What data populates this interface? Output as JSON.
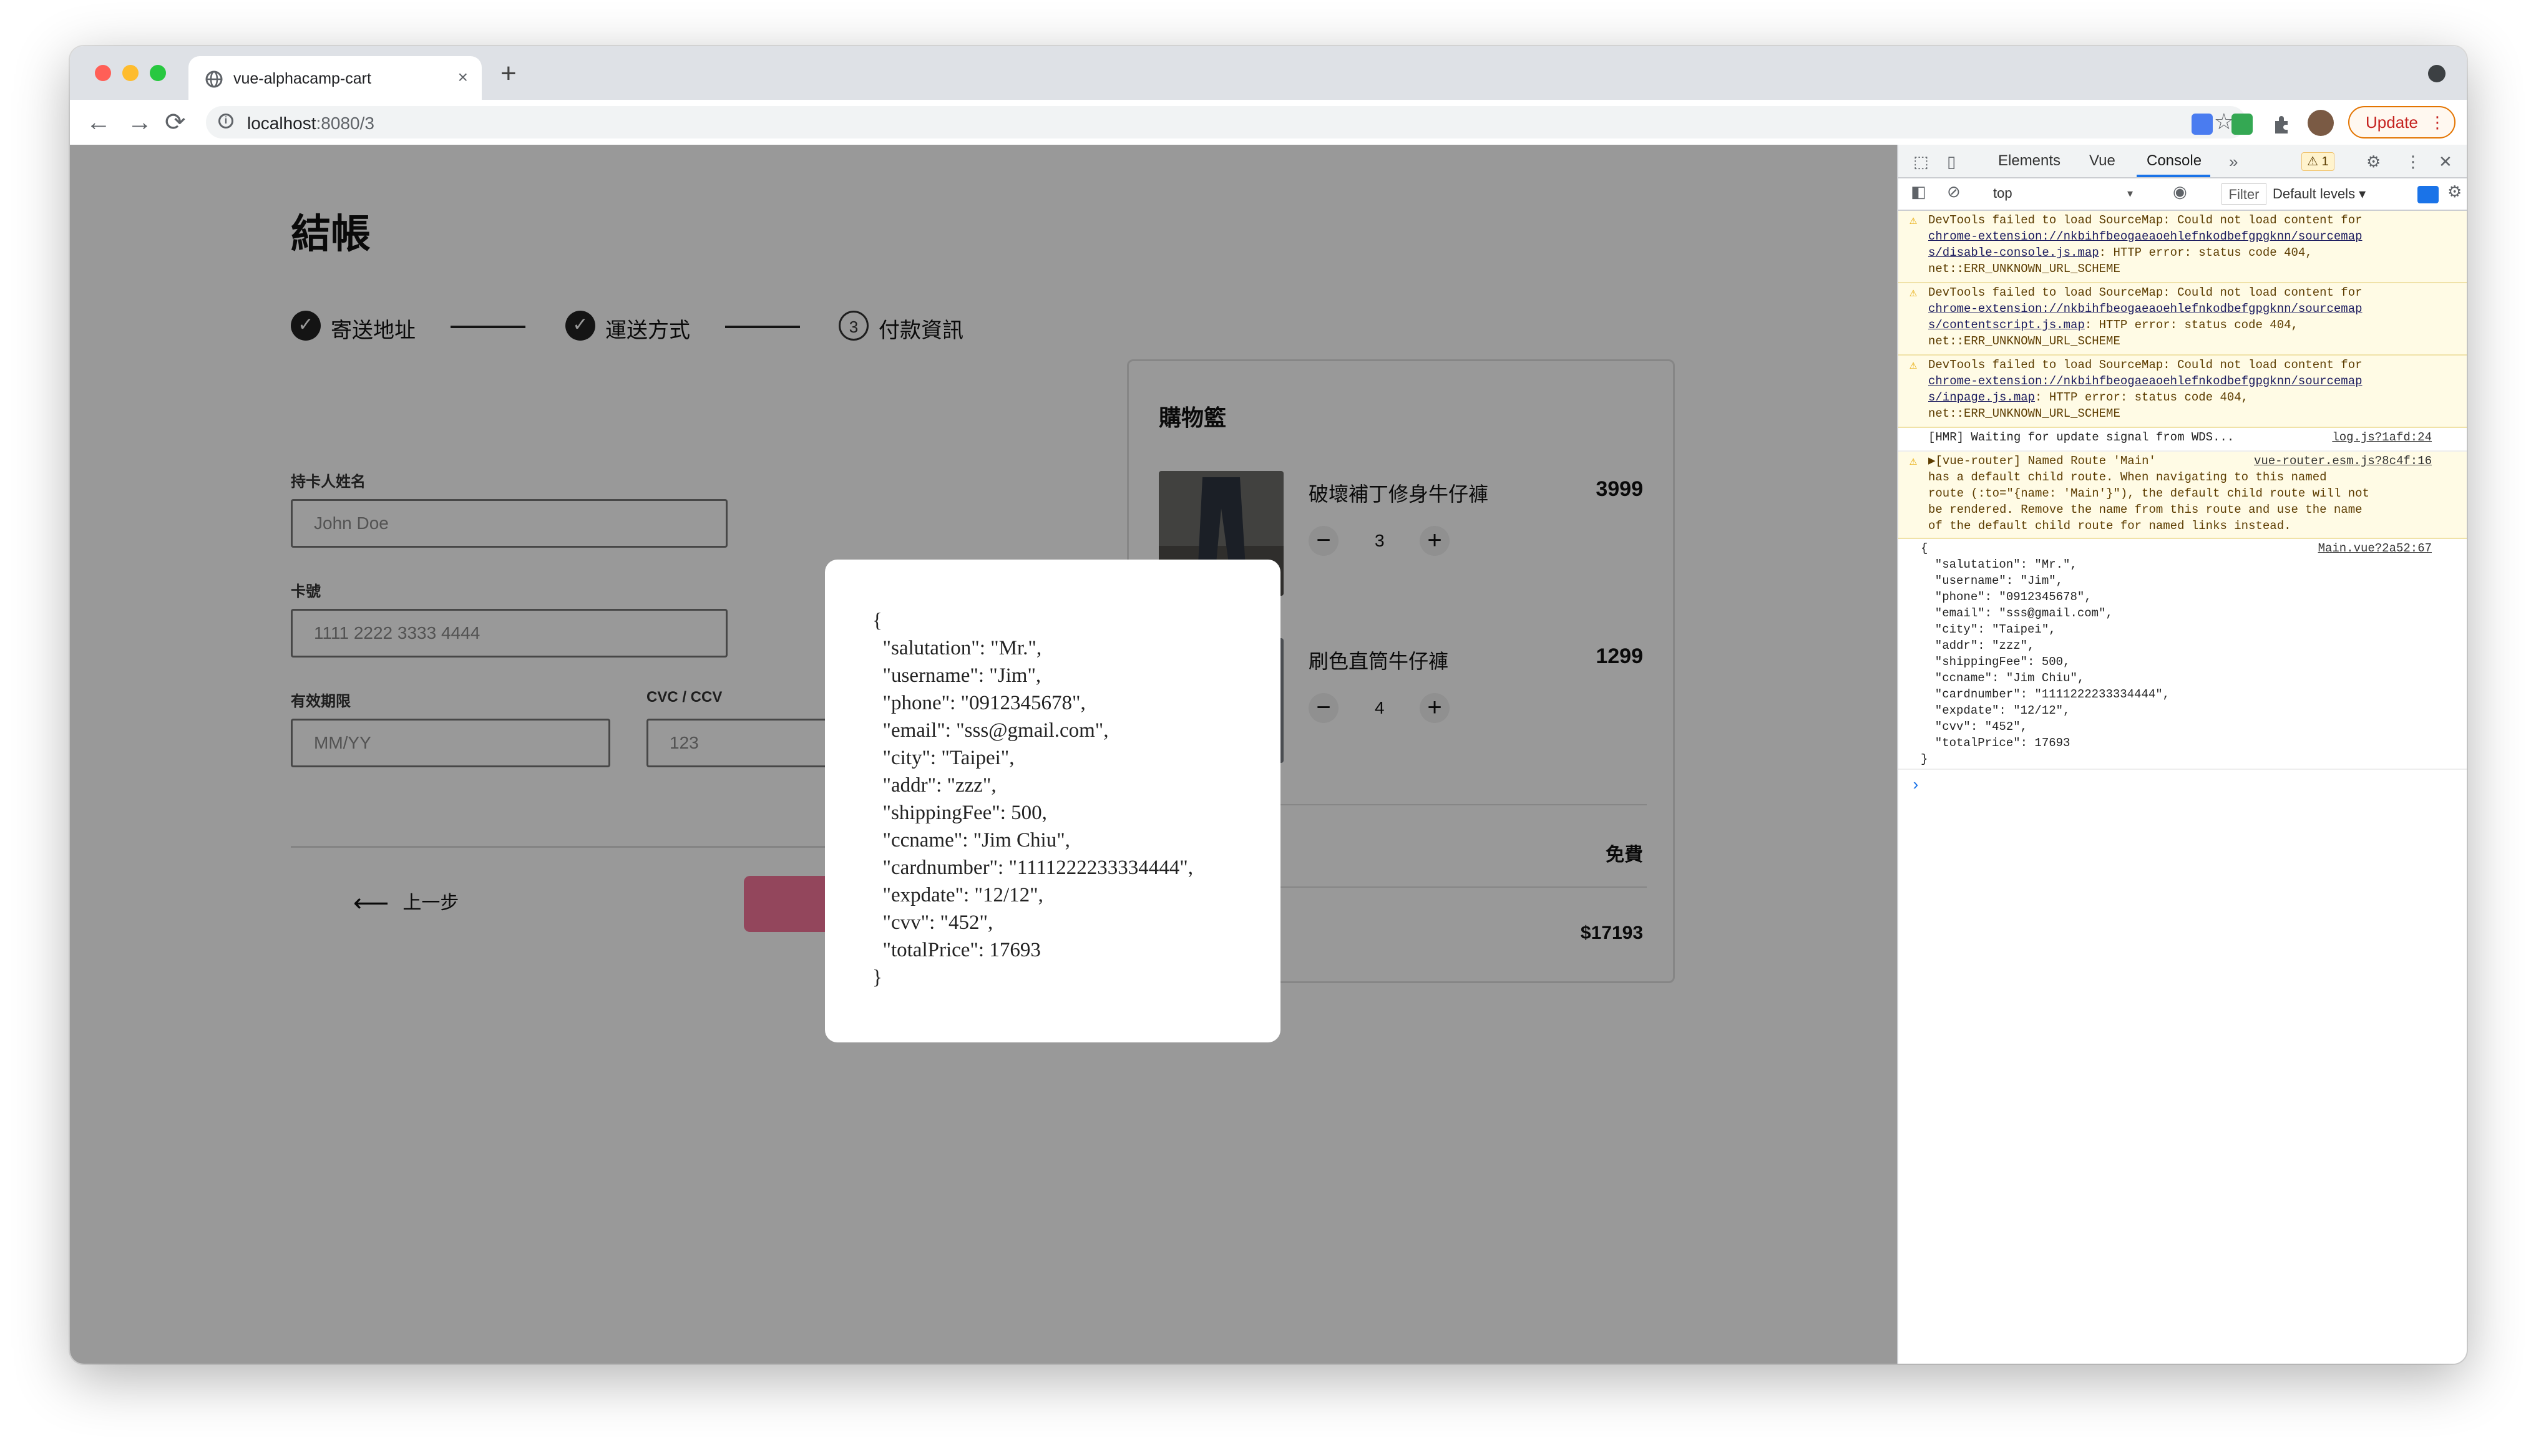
{
  "browser": {
    "tab_title": "vue-alphacamp-cart",
    "tab_close": "×",
    "new_tab": "+",
    "url_host": "localhost",
    "url_port": ":8080/3",
    "update_label": "Update",
    "update_more": "⋮",
    "nav": {
      "back": "←",
      "forward": "→",
      "reload": "⟳",
      "star": "☆"
    },
    "traffic_colors": [
      "#ff5f57",
      "#febc2e",
      "#28c840"
    ]
  },
  "checkout": {
    "title": "結帳",
    "steps": [
      {
        "label": "寄送地址",
        "mark": "✓"
      },
      {
        "label": "運送方式",
        "mark": "✓"
      },
      {
        "label": "付款資訊",
        "mark": "3"
      }
    ],
    "fields": {
      "ccname_label": "持卡人姓名",
      "ccname_placeholder": "John Doe",
      "cardnumber_label": "卡號",
      "cardnumber_placeholder": "1111 2222 3333 4444",
      "expdate_label": "有效期限",
      "expdate_placeholder": "MM/YY",
      "cvv_label": "CVC / CCV",
      "cvv_placeholder": "123"
    },
    "prev_label": "上一步",
    "prev_arrow": "⟵",
    "accent_color": "#f67599"
  },
  "cart": {
    "title": "購物籃",
    "items": [
      {
        "name": "破壞補丁修身牛仔褲",
        "price": "3999",
        "qty": "3"
      },
      {
        "name": "刷色直筒牛仔褲",
        "price": "1299",
        "qty": "4"
      }
    ],
    "minus": "−",
    "plus": "+",
    "shipping_value": "免費",
    "total_value": "$17193"
  },
  "modal": {
    "json_text": "{\n  \"salutation\": \"Mr.\",\n  \"username\": \"Jim\",\n  \"phone\": \"0912345678\",\n  \"email\": \"sss@gmail.com\",\n  \"city\": \"Taipei\",\n  \"addr\": \"zzz\",\n  \"shippingFee\": 500,\n  \"ccname\": \"Jim Chiu\",\n  \"cardnumber\": \"1111222233334444\",\n  \"expdate\": \"12/12\",\n  \"cvv\": \"452\",\n  \"totalPrice\": 17693\n}"
  },
  "devtools": {
    "tabs": [
      "Elements",
      "Vue",
      "Console"
    ],
    "more_tabs": "»",
    "warning_count": "⚠ 1",
    "context": "top",
    "context_caret": "▾",
    "filter_label": "Filter",
    "levels_label": "Default levels ▾",
    "messages": [
      {
        "pre": "DevTools failed to load SourceMap: Could not load content for\n",
        "link": "chrome-extension://nkbihfbeogaeaoehlefnkodbefgpgknn/sourcemap\ns/disable-console.js.map",
        "post": ": HTTP error: status code 404,\nnet::ERR_UNKNOWN_URL_SCHEME"
      },
      {
        "pre": "DevTools failed to load SourceMap: Could not load content for\n",
        "link": "chrome-extension://nkbihfbeogaeaoehlefnkodbefgpgknn/sourcemap\ns/contentscript.js.map",
        "post": ": HTTP error: status code 404,\nnet::ERR_UNKNOWN_URL_SCHEME"
      },
      {
        "pre": "DevTools failed to load SourceMap: Could not load content for\n",
        "link": "chrome-extension://nkbihfbeogaeaoehlefnkodbefgpgknn/sourcemap\ns/inpage.js.map",
        "post": ": HTTP error: status code 404,\nnet::ERR_UNKNOWN_URL_SCHEME"
      }
    ],
    "hmr_text": "[HMR] Waiting for update signal from WDS...",
    "hmr_source": "log.js?1afd:24",
    "router_text": "▶[vue-router] Named Route 'Main'\nhas a default child route. When navigating to this named\nroute (:to=\"{name: 'Main'}\"), the default child route will not\nbe rendered. Remove the name from this route and use the name\nof the default child route for named links instead.",
    "router_source": "vue-router.esm.js?8c4f:16",
    "log_source": "Main.vue?2a52:67",
    "log_text": "{\n  \"salutation\": \"Mr.\",\n  \"username\": \"Jim\",\n  \"phone\": \"0912345678\",\n  \"email\": \"sss@gmail.com\",\n  \"city\": \"Taipei\",\n  \"addr\": \"zzz\",\n  \"shippingFee\": 500,\n  \"ccname\": \"Jim Chiu\",\n  \"cardnumber\": \"1111222233334444\",\n  \"expdate\": \"12/12\",\n  \"cvv\": \"452\",\n  \"totalPrice\": 17693\n}",
    "prompt": "›"
  }
}
